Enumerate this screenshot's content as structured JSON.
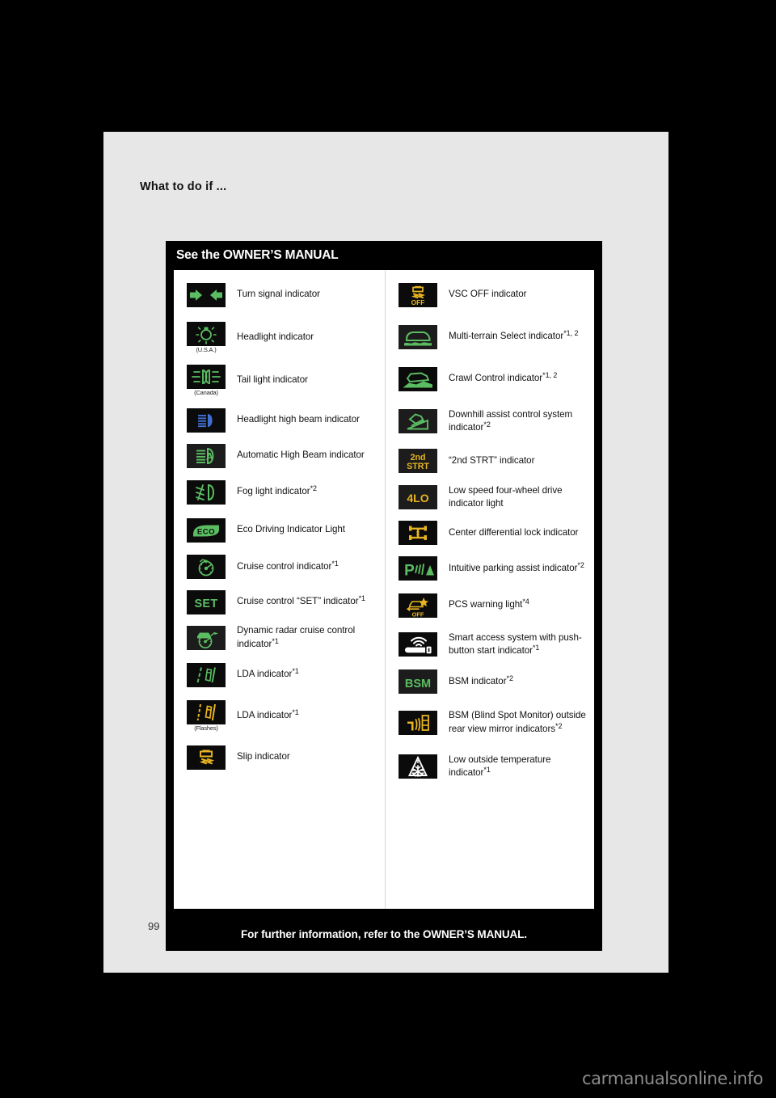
{
  "page": {
    "header": "What to do if ...",
    "number": "99",
    "watermark": "carmanualsonline.info"
  },
  "panel": {
    "title": "See the OWNER’S MANUAL",
    "footer": "For further information, refer to the OWNER’S MANUAL."
  },
  "colors": {
    "green": "#5bbd62",
    "amber": "#e8b521",
    "blue": "#3f6fd0",
    "white": "#ffffff",
    "icon_bg": "#0b0b0b",
    "icon_bg_dim": "#1c1c1c",
    "panel_bg": "#000000",
    "sheet_bg": "#e7e7e7"
  },
  "left_column": [
    {
      "icon": "turn-signal-icon",
      "label": "Turn signal indicator",
      "sup": "",
      "note": ""
    },
    {
      "icon": "headlight-icon",
      "label": "Headlight indicator",
      "sup": "",
      "note": "(U.S.A.)"
    },
    {
      "icon": "tail-light-icon",
      "label": "Tail light indicator",
      "sup": "",
      "note": "(Canada)"
    },
    {
      "icon": "high-beam-icon",
      "label": "Headlight high beam indicator",
      "sup": "",
      "note": ""
    },
    {
      "icon": "automatic-high-beam-icon",
      "label": "Automatic High Beam indicator",
      "sup": "",
      "note": ""
    },
    {
      "icon": "fog-light-icon",
      "label": "Fog light indicator",
      "sup": "*2",
      "note": ""
    },
    {
      "icon": "eco-driving-icon",
      "label": "Eco Driving Indicator Light",
      "sup": "",
      "note": ""
    },
    {
      "icon": "cruise-control-icon",
      "label": "Cruise control indicator",
      "sup": "*1",
      "note": ""
    },
    {
      "icon": "cruise-control-set-icon",
      "label": "Cruise control “SET” indicator",
      "sup": "*1",
      "note": ""
    },
    {
      "icon": "dynamic-radar-cruise-icon",
      "label": "Dynamic radar cruise control indicator",
      "sup": "*1",
      "note": ""
    },
    {
      "icon": "lda-green-icon",
      "label": "LDA indicator",
      "sup": "*1",
      "note": ""
    },
    {
      "icon": "lda-amber-icon",
      "label": "LDA indicator",
      "sup": "*1",
      "note": "(Flashes)"
    },
    {
      "icon": "slip-indicator-icon",
      "label": "Slip indicator",
      "sup": "",
      "note": ""
    }
  ],
  "right_column": [
    {
      "icon": "vsc-off-icon",
      "label": "VSC OFF indicator",
      "sup": "",
      "note": ""
    },
    {
      "icon": "multi-terrain-select-icon",
      "label": "Multi-terrain Select indicator",
      "sup": "*1, 2",
      "note": ""
    },
    {
      "icon": "crawl-control-icon",
      "label": "Crawl Control indicator",
      "sup": "*1, 2",
      "note": ""
    },
    {
      "icon": "downhill-assist-icon",
      "label": "Downhill assist control system indicator",
      "sup": "*2",
      "note": ""
    },
    {
      "icon": "second-start-icon",
      "label": "“2nd STRT” indicator",
      "sup": "",
      "note": ""
    },
    {
      "icon": "four-lo-icon",
      "label": "Low speed four-wheel drive indicator light",
      "sup": "",
      "note": ""
    },
    {
      "icon": "center-diff-lock-icon",
      "label": "Center differential lock indicator",
      "sup": "",
      "note": ""
    },
    {
      "icon": "intuitive-parking-assist-icon",
      "label": "Intuitive parking assist indicator",
      "sup": "*2",
      "note": ""
    },
    {
      "icon": "pcs-warning-icon",
      "label": "PCS warning light",
      "sup": "*4",
      "note": ""
    },
    {
      "icon": "smart-access-key-icon",
      "label": "Smart access system with push-button start indicator",
      "sup": "*1",
      "note": ""
    },
    {
      "icon": "bsm-icon",
      "label": "BSM indicator",
      "sup": "*2",
      "note": ""
    },
    {
      "icon": "bsm-mirror-icon",
      "label": "BSM (Blind Spot Monitor) outside rear view mirror indicators",
      "sup": "*2",
      "note": ""
    },
    {
      "icon": "low-outside-temperature-icon",
      "label": "Low outside temperature indicator",
      "sup": "*1",
      "note": ""
    }
  ]
}
